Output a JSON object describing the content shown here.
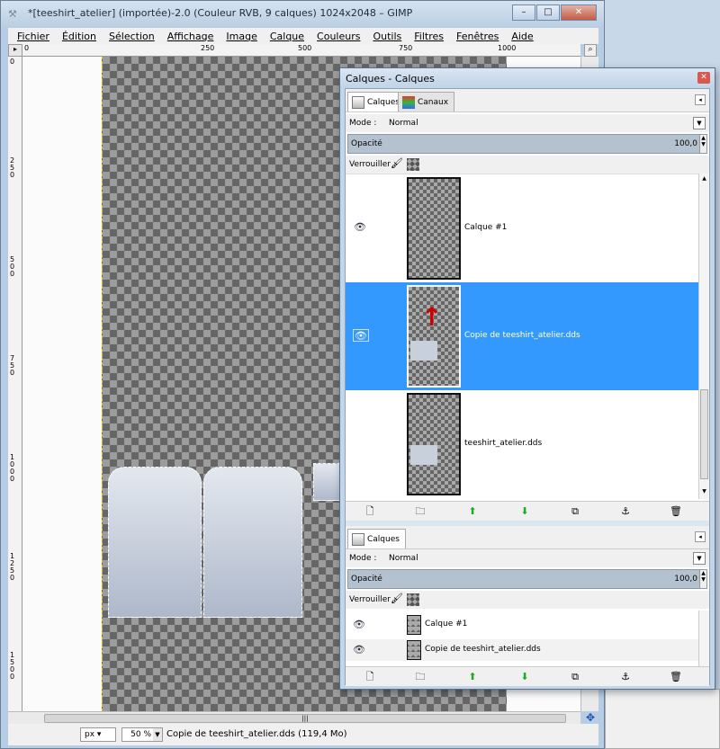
{
  "window": {
    "title": "*[teeshirt_atelier] (importée)-2.0 (Couleur RVB, 9 calques) 1024x2048 – GIMP",
    "controls": [
      "–",
      "□",
      "✕"
    ]
  },
  "menu": [
    "Fichier",
    "Édition",
    "Sélection",
    "Affichage",
    "Image",
    "Calque",
    "Couleurs",
    "Outils",
    "Filtres",
    "Fenêtres",
    "Aide"
  ],
  "ruler": {
    "horizontal": [
      "0",
      "250",
      "500",
      "750",
      "1000"
    ],
    "vertical": [
      "0",
      "250",
      "500",
      "750",
      "1000",
      "1250",
      "1500"
    ]
  },
  "status": {
    "unit": "px",
    "zoom": "50 %",
    "text": "Copie de teeshirt_atelier.dds (119,4 Mo)"
  },
  "dock": {
    "title": "Calques - Calques",
    "tabs": [
      "Calques",
      "Canaux"
    ],
    "mode_label": "Mode :",
    "mode_value": "Normal",
    "opacity_label": "Opacité",
    "opacity_value": "100,0",
    "lock_label": "Verrouiller :",
    "layers": [
      {
        "name": "Calque #1",
        "visible": true,
        "selected": false
      },
      {
        "name": "Copie de teeshirt_atelier.dds",
        "visible": true,
        "selected": true
      },
      {
        "name": "teeshirt_atelier.dds",
        "visible": true,
        "selected": false
      }
    ],
    "buttons": [
      "new-layer",
      "new-group",
      "raise",
      "lower",
      "duplicate",
      "anchor",
      "delete"
    ],
    "second_panel": {
      "tab": "Calques",
      "mode_label": "Mode :",
      "mode_value": "Normal",
      "opacity_label": "Opacité",
      "opacity_value": "100,0",
      "lock_label": "Verrouiller :",
      "layers": [
        {
          "name": "Calque #1"
        },
        {
          "name": "Copie de teeshirt_atelier.dds"
        }
      ]
    }
  },
  "colors": {
    "selection": "#3399ff",
    "annotation": "#cc0000"
  }
}
